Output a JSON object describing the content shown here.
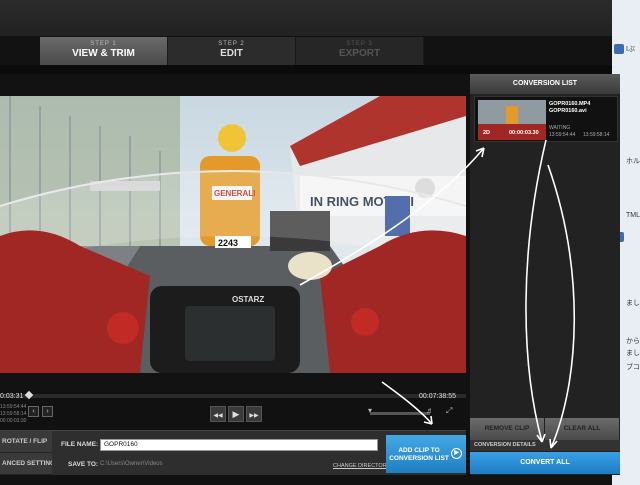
{
  "steps": [
    {
      "num": "STEP 1",
      "label": "VIEW & TRIM"
    },
    {
      "num": "STEP 2",
      "label": "EDIT"
    },
    {
      "num": "STEP 3",
      "label": "EXPORT"
    }
  ],
  "video": {
    "overlay_brand": "OSTARZ",
    "banner_text": "IN RING MOTEGI",
    "banner_text_2": "MOTEGI",
    "bike_number": "2243",
    "rider_text": "GENERALI"
  },
  "timeline": {
    "current": "0:03:31",
    "end": "00:07:38:55",
    "info_lines": [
      "13:59:54:44",
      "13:59:58:14",
      "00:00:03:30"
    ]
  },
  "transport": {
    "prev": "◀◀",
    "play": "▶",
    "next": "▶▶"
  },
  "bottom": {
    "tab1": "ROTATE / FLIP",
    "tab2": "ANCED SETTINGS",
    "file_name_label": "FILE NAME:",
    "file_name_value": "GOPR0160",
    "save_to_label": "SAVE TO:",
    "save_to_value": "C:\\Users\\Owner\\Videos",
    "change_directory": "CHANGE DIRECTORY",
    "add_clip": "ADD CLIP TO CONVERSION LIST"
  },
  "panel": {
    "title": "CONVERSION LIST",
    "clip": {
      "file1": "GOPR0160.MP4",
      "file2": "GOPR0160.avi",
      "status": "WAITING",
      "time_in": "13:59:54:44",
      "time_out": "13:59:58:14",
      "badge": "2D",
      "duration": "00:00:03.30"
    },
    "remove_clip": "REMOVE CLIP",
    "clear_all": "CLEAR ALL",
    "details": "CONVERSION DETAILS",
    "convert_all": "CONVERT ALL"
  },
  "desktop": {
    "lines": [
      "Iぶ",
      "ホル",
      "TML",
      "まし",
      "から",
      "まし",
      "ブコン"
    ]
  },
  "colors": {
    "accent": "#2a8fd6",
    "background": "#121212"
  }
}
